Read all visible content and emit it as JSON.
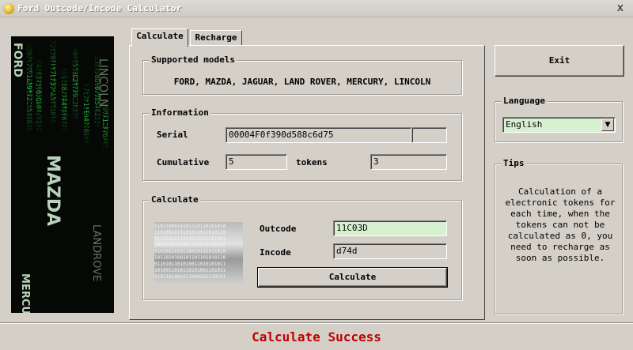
{
  "window": {
    "title": "Ford Outcode/Incode Calculator",
    "close_glyph": "x"
  },
  "tabs": [
    {
      "label": "Calculate"
    },
    {
      "label": "Recharge"
    }
  ],
  "supported": {
    "group_label": "Supported models",
    "models": "FORD, MAZDA, JAGUAR, LAND ROVER, MERCURY, LINCOLN"
  },
  "information": {
    "group_label": "Information",
    "serial_label": "Serial",
    "serial_value": "00004F0f390d588c6d75",
    "cumulative_label": "Cumulative",
    "cumulative_value": "5",
    "tokens_label": "tokens",
    "tokens_value": "3"
  },
  "calculate": {
    "group_label": "Calculate",
    "outcode_label": "Outcode",
    "outcode_value": "11C03D",
    "incode_label": "Incode",
    "incode_value": "d74d",
    "button_label": "Calculate"
  },
  "sidebar": {
    "exit_label": "Exit",
    "language_label": "Language",
    "language_value": "English",
    "tips_label": "Tips",
    "tips_text": "Calculation of a electronic tokens for each time, when the tokens can not be calculated as 0, you need to recharge as soon as possible."
  },
  "banner_words": [
    "FORD",
    "MAZDA",
    "MERCU",
    "LINCOLN",
    "LANDROVE"
  ],
  "status": {
    "message": "Calculate Success",
    "color": "#c00000"
  },
  "icons": {
    "app": "app-coin-icon",
    "close": "close-icon",
    "dropdown": "chevron-down-icon",
    "banner": "matrix-banner-image",
    "binary": "binary-code-image"
  }
}
